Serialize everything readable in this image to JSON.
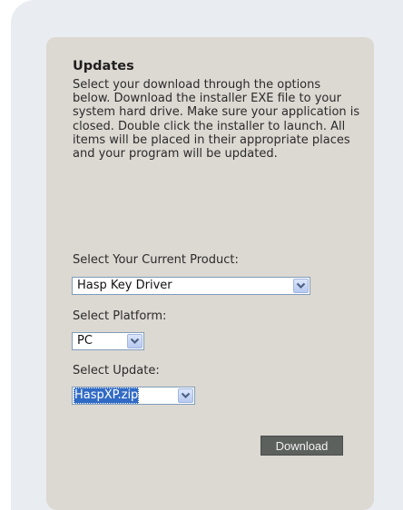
{
  "updates": {
    "title": "Updates",
    "description": "Select your download through the options below. Download the installer EXE file to your system hard drive. Make sure your application is closed. Double click the installer to launch. All items will be placed in their appropriate places and your program will be updated."
  },
  "product": {
    "label": "Select Your Current Product:",
    "selected": "Hasp Key Driver"
  },
  "platform": {
    "label": "Select Platform:",
    "selected": "PC"
  },
  "update": {
    "label": "Select Update:",
    "selected": "HaspXP.zip"
  },
  "download": {
    "label": "Download"
  },
  "colors": {
    "panel_bg": "#dcd8d2",
    "frame_bg": "#e9ecf1",
    "button_bg": "#5c615e",
    "selection": "#316ac5"
  }
}
